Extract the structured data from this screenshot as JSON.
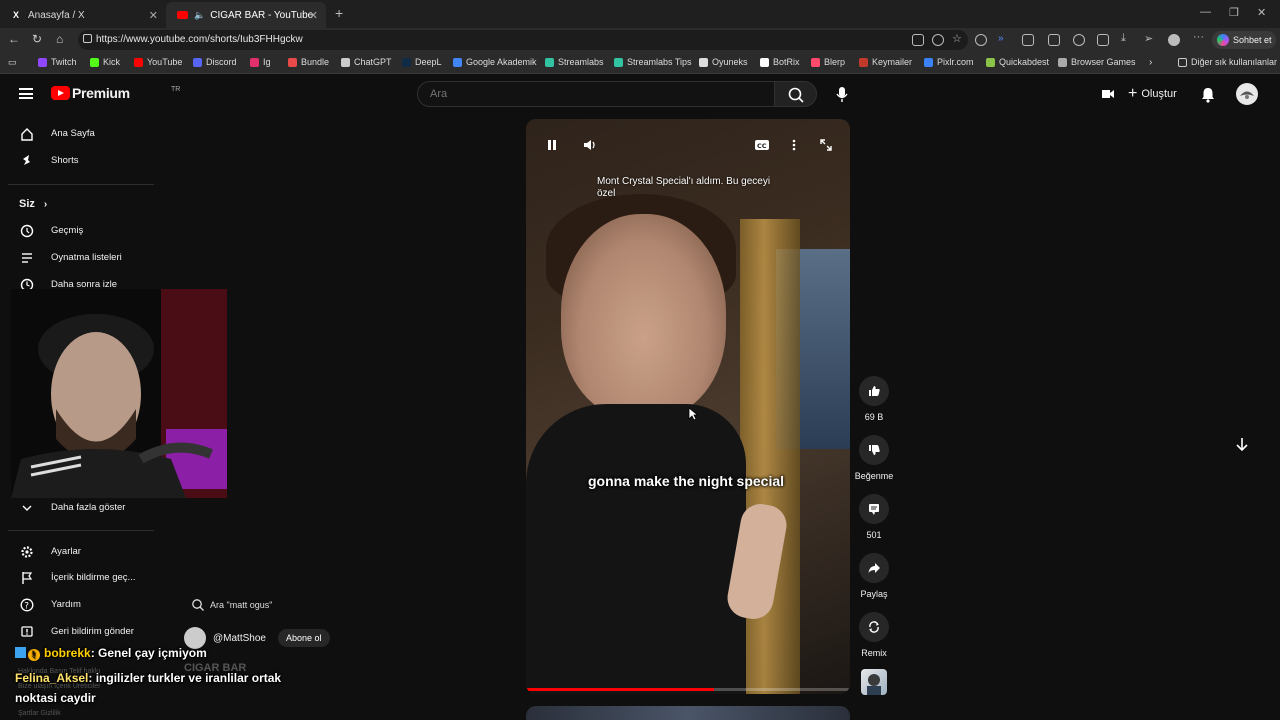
{
  "browser": {
    "tabs": [
      {
        "label": "Anasayfa / X",
        "icon": "x-logo-icon"
      },
      {
        "label": "CIGAR BAR - YouTube",
        "icon": "youtube-icon"
      }
    ],
    "url": "https://www.youtube.com/shorts/Iub3FHHgckw",
    "copilot_label": "Sohbet et",
    "bookmarks": [
      {
        "label": "Twitch",
        "color": "#9146ff"
      },
      {
        "label": "Kick",
        "color": "#53fc18"
      },
      {
        "label": "YouTube",
        "color": "#ff0000"
      },
      {
        "label": "Discord",
        "color": "#5865f2"
      },
      {
        "label": "Ig",
        "color": "#e1306c"
      },
      {
        "label": "Bundle",
        "color": "#e84a4a"
      },
      {
        "label": "ChatGPT",
        "color": "#cccccc"
      },
      {
        "label": "DeepL",
        "color": "#0f2b46"
      },
      {
        "label": "Google Akademik",
        "color": "#4285f4"
      },
      {
        "label": "Streamlabs",
        "color": "#31c3a2"
      },
      {
        "label": "Streamlabs Tips",
        "color": "#31c3a2"
      },
      {
        "label": "Oyuneks",
        "color": "#dddddd"
      },
      {
        "label": "BotRix",
        "color": "#ffffff"
      },
      {
        "label": "Blerp",
        "color": "#ff4a6b"
      },
      {
        "label": "Keymailer",
        "color": "#c0392b"
      },
      {
        "label": "Pixlr.com",
        "color": "#3b82f6"
      },
      {
        "label": "Quickabdest",
        "color": "#8bc34a"
      },
      {
        "label": "Browser Games",
        "color": "#aaaaaa"
      }
    ],
    "other_bookmarks": "Diğer sık kullanılanlar"
  },
  "youtube": {
    "logo_text": "Premium",
    "country": "TR",
    "search_placeholder": "Ara",
    "create_label": "Oluştur",
    "sidebar": {
      "top": [
        {
          "label": "Ana Sayfa",
          "icon": "home-icon"
        },
        {
          "label": "Shorts",
          "icon": "shorts-icon"
        }
      ],
      "you_header": "Siz",
      "you": [
        {
          "label": "Geçmiş",
          "icon": "history-icon"
        },
        {
          "label": "Oynatma listeleri",
          "icon": "playlist-icon"
        },
        {
          "label": "Daha sonra izle",
          "icon": "watch-later-icon"
        }
      ],
      "show_more": "Daha fazla göster",
      "bottom": [
        {
          "label": "Ayarlar",
          "icon": "settings-icon"
        },
        {
          "label": "İçerik bildirme geç...",
          "icon": "flag-icon"
        },
        {
          "label": "Yardım",
          "icon": "help-icon"
        },
        {
          "label": "Geri bildirim gönder",
          "icon": "feedback-icon"
        }
      ],
      "footer": [
        "Hakkında  Basın  Telif hakkı",
        "Bize ulaşın  İçerik Üreticiler",
        "Şartlar  Gizlilik"
      ]
    },
    "short": {
      "description": "Mont Crystal Special'ı aldım.  Bu geceyi özel",
      "caption": "gonna make the night special",
      "progress": 0.58,
      "title": "CIGAR BAR",
      "channel": "@MattShoe",
      "subscribe": "Abone ol",
      "search_suggestion": "Ara \"matt ogus\""
    },
    "actions": [
      {
        "label": "69 B",
        "icon": "like-icon"
      },
      {
        "label": "Beğenme",
        "icon": "dislike-icon"
      },
      {
        "label": "501",
        "icon": "comment-icon"
      },
      {
        "label": "Paylaş",
        "icon": "share-icon"
      },
      {
        "label": "Remix",
        "icon": "remix-icon"
      }
    ]
  },
  "chat": [
    {
      "user": "bobrekk",
      "message": ": Genel çay içmiyom"
    },
    {
      "user": "Felina_Aksel",
      "message": ": ingilizler turkler ve iranlilar ortak noktasi caydir"
    }
  ]
}
